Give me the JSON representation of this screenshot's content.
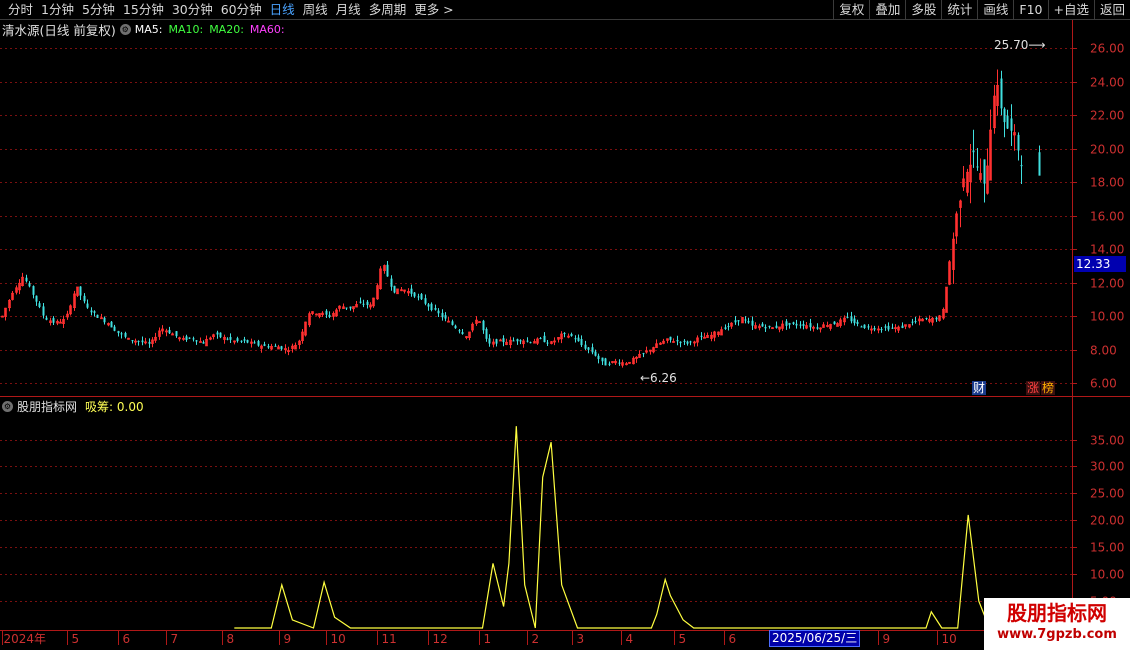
{
  "toolbar": {
    "periods": [
      "分时",
      "1分钟",
      "5分钟",
      "15分钟",
      "30分钟",
      "60分钟",
      "日线",
      "周线",
      "月线",
      "多周期",
      "更多 >"
    ],
    "active_period": "日线",
    "actions": [
      "复权",
      "叠加",
      "多股",
      "统计",
      "画线",
      "F10",
      "+自选",
      "返回"
    ]
  },
  "main_panel": {
    "title": "清水源(日线 前复权)",
    "ma_labels": [
      {
        "text": "MA5:",
        "color": "#ffffff"
      },
      {
        "text": "MA10:",
        "color": "#40ff40"
      },
      {
        "text": "MA20:",
        "color": "#40ff40"
      },
      {
        "text": "MA60:",
        "color": "#ff40ff"
      }
    ],
    "y_ticks": [
      "26.00",
      "24.00",
      "22.00",
      "20.00",
      "18.00",
      "16.00",
      "14.00",
      "12.00",
      "10.00",
      "8.00",
      "6.00"
    ],
    "current_price": "12.33",
    "high_label": "25.70",
    "low_label": "6.26",
    "tags": {
      "fin": "财",
      "zhang": "涨",
      "bang": "榜"
    }
  },
  "sub_panel": {
    "name": "股朋指标网",
    "line_label": "吸筹: 0.00",
    "y_ticks": [
      "35.00",
      "30.00",
      "25.00",
      "20.00",
      "15.00",
      "10.00",
      "5.00"
    ]
  },
  "x_axis": {
    "labels": [
      "2024年",
      "5",
      "6",
      "7",
      "8",
      "9",
      "10",
      "11",
      "12",
      "1",
      "2",
      "3",
      "4",
      "5",
      "6",
      "7",
      "8",
      "9",
      "10"
    ],
    "cursor_date": "2025/06/25/三"
  },
  "watermark": {
    "title": "股朋指标网",
    "url": "www.7gpzb.com"
  },
  "colors": {
    "up": "#ff3030",
    "down": "#40e0e0",
    "indicator": "#ffff40",
    "grid": "#7a1010",
    "axis": "#b01818",
    "price_box": "#0000b0"
  },
  "chart_data": [
    {
      "type": "candlestick",
      "title": "清水源(日线 前复权)",
      "ylim": [
        5.6,
        26.8
      ],
      "yticks": [
        6,
        8,
        10,
        12,
        14,
        16,
        18,
        20,
        22,
        24,
        26
      ],
      "closes": [
        [
          0.0,
          10.0
        ],
        [
          0.01,
          11.5
        ],
        [
          0.02,
          12.4
        ],
        [
          0.03,
          11.2
        ],
        [
          0.04,
          9.9
        ],
        [
          0.05,
          9.6
        ],
        [
          0.06,
          9.8
        ],
        [
          0.07,
          11.8
        ],
        [
          0.08,
          10.5
        ],
        [
          0.09,
          10.0
        ],
        [
          0.1,
          9.6
        ],
        [
          0.11,
          9.0
        ],
        [
          0.12,
          8.6
        ],
        [
          0.13,
          8.5
        ],
        [
          0.14,
          8.3
        ],
        [
          0.15,
          9.3
        ],
        [
          0.16,
          9.0
        ],
        [
          0.17,
          8.6
        ],
        [
          0.18,
          8.7
        ],
        [
          0.19,
          8.4
        ],
        [
          0.2,
          8.9
        ],
        [
          0.21,
          8.7
        ],
        [
          0.22,
          8.5
        ],
        [
          0.23,
          8.5
        ],
        [
          0.24,
          8.3
        ],
        [
          0.25,
          8.2
        ],
        [
          0.26,
          8.2
        ],
        [
          0.27,
          8.0
        ],
        [
          0.28,
          8.4
        ],
        [
          0.29,
          10.2
        ],
        [
          0.3,
          10.2
        ],
        [
          0.31,
          10.0
        ],
        [
          0.32,
          10.6
        ],
        [
          0.33,
          10.5
        ],
        [
          0.34,
          10.8
        ],
        [
          0.35,
          10.6
        ],
        [
          0.36,
          13.2
        ],
        [
          0.37,
          11.5
        ],
        [
          0.38,
          11.6
        ],
        [
          0.39,
          11.3
        ],
        [
          0.4,
          10.8
        ],
        [
          0.41,
          10.3
        ],
        [
          0.42,
          9.8
        ],
        [
          0.43,
          9.3
        ],
        [
          0.44,
          8.8
        ],
        [
          0.45,
          10.0
        ],
        [
          0.46,
          8.3
        ],
        [
          0.47,
          8.5
        ],
        [
          0.48,
          8.5
        ],
        [
          0.49,
          8.6
        ],
        [
          0.5,
          8.5
        ],
        [
          0.51,
          8.6
        ],
        [
          0.52,
          8.4
        ],
        [
          0.53,
          8.9
        ],
        [
          0.54,
          8.8
        ],
        [
          0.55,
          8.2
        ],
        [
          0.56,
          7.8
        ],
        [
          0.57,
          7.1
        ],
        [
          0.58,
          7.3
        ],
        [
          0.59,
          7.2
        ],
        [
          0.6,
          7.5
        ],
        [
          0.61,
          7.9
        ],
        [
          0.62,
          8.3
        ],
        [
          0.63,
          8.6
        ],
        [
          0.64,
          8.5
        ],
        [
          0.65,
          8.4
        ],
        [
          0.66,
          8.7
        ],
        [
          0.67,
          8.8
        ],
        [
          0.68,
          9.2
        ],
        [
          0.69,
          9.5
        ],
        [
          0.7,
          9.9
        ],
        [
          0.71,
          9.4
        ],
        [
          0.72,
          9.4
        ],
        [
          0.73,
          9.3
        ],
        [
          0.74,
          9.5
        ],
        [
          0.75,
          9.5
        ],
        [
          0.76,
          9.5
        ],
        [
          0.77,
          9.3
        ],
        [
          0.78,
          9.5
        ],
        [
          0.79,
          9.6
        ],
        [
          0.8,
          9.9
        ],
        [
          0.81,
          9.5
        ],
        [
          0.82,
          9.3
        ],
        [
          0.83,
          9.3
        ],
        [
          0.84,
          9.3
        ],
        [
          0.85,
          9.3
        ],
        [
          0.86,
          9.6
        ],
        [
          0.87,
          9.8
        ],
        [
          0.88,
          9.8
        ],
        [
          0.89,
          10.0
        ],
        [
          0.9,
          14.5
        ],
        [
          0.91,
          18.5
        ],
        [
          0.92,
          19.6
        ],
        [
          0.93,
          17.5
        ],
        [
          0.94,
          24.0
        ],
        [
          0.95,
          21.5
        ],
        [
          0.96,
          20.4
        ],
        [
          1.0,
          12.33
        ]
      ]
    },
    {
      "type": "line",
      "series": [
        {
          "name": "吸筹",
          "values": [
            [
              0.22,
              0
            ],
            [
              0.255,
              0
            ],
            [
              0.265,
              8.0
            ],
            [
              0.275,
              1.5
            ],
            [
              0.295,
              0
            ],
            [
              0.305,
              8.5
            ],
            [
              0.315,
              2.0
            ],
            [
              0.33,
              0
            ],
            [
              0.455,
              0
            ],
            [
              0.465,
              12.0
            ],
            [
              0.475,
              4.0
            ],
            [
              0.48,
              12.0
            ],
            [
              0.487,
              37.5
            ],
            [
              0.495,
              8.0
            ],
            [
              0.505,
              0
            ],
            [
              0.512,
              28.0
            ],
            [
              0.52,
              34.5
            ],
            [
              0.53,
              8.0
            ],
            [
              0.545,
              0
            ],
            [
              0.615,
              0
            ],
            [
              0.62,
              2.5
            ],
            [
              0.628,
              9.0
            ],
            [
              0.633,
              6.0
            ],
            [
              0.645,
              1.5
            ],
            [
              0.655,
              0
            ],
            [
              0.875,
              0
            ],
            [
              0.88,
              3.0
            ],
            [
              0.89,
              0
            ],
            [
              0.905,
              0
            ],
            [
              0.915,
              21.0
            ],
            [
              0.925,
              5.0
            ],
            [
              0.935,
              0
            ],
            [
              0.96,
              0
            ]
          ]
        }
      ],
      "ylim": [
        0,
        39
      ],
      "yticks": [
        5,
        10,
        15,
        20,
        25,
        30,
        35
      ]
    }
  ]
}
